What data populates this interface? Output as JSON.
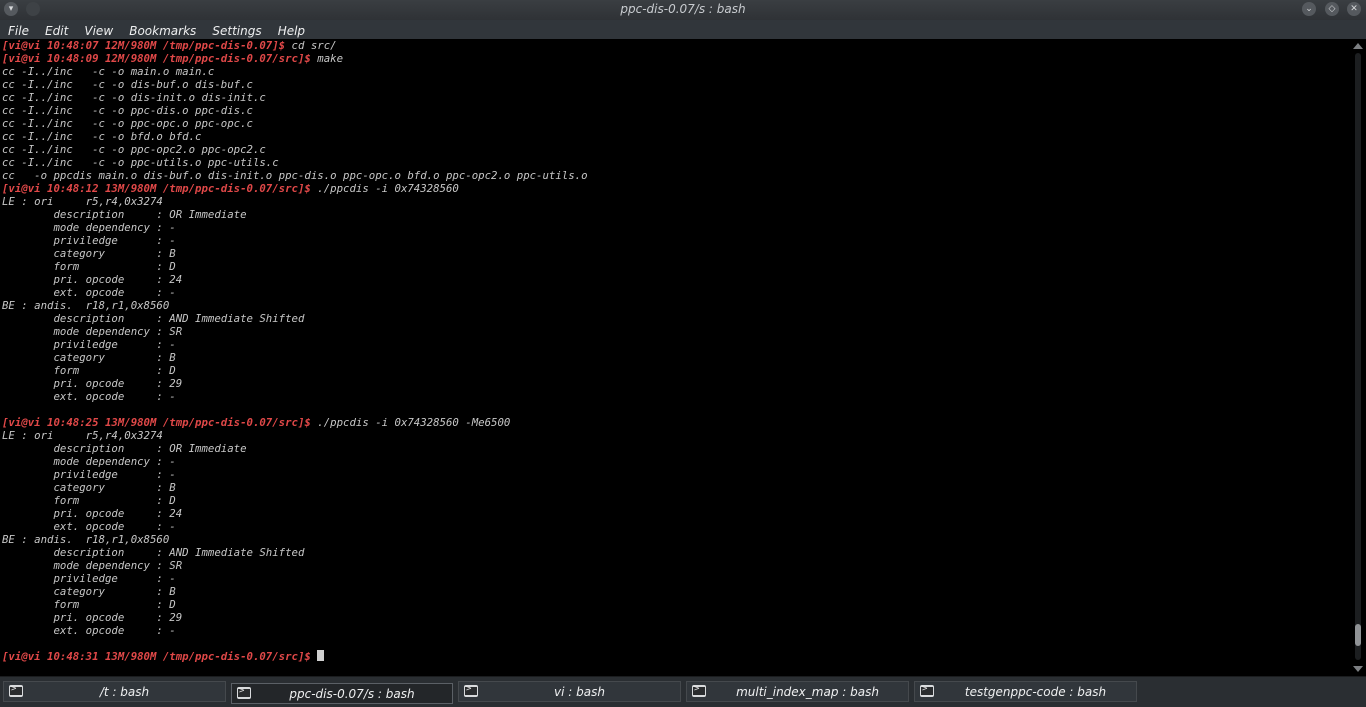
{
  "window": {
    "title": "ppc-dis-0.07/s : bash"
  },
  "menu": [
    "File",
    "Edit",
    "View",
    "Bookmarks",
    "Settings",
    "Help"
  ],
  "terminal": {
    "lines": [
      {
        "prompt": "[vi@vi 10:48:07 12M/980M /tmp/ppc-dis-0.07]$",
        "text": " cd src/"
      },
      {
        "prompt": "[vi@vi 10:48:09 12M/980M /tmp/ppc-dis-0.07/src]$",
        "text": " make"
      },
      {
        "prompt": "",
        "text": "cc -I../inc   -c -o main.o main.c"
      },
      {
        "prompt": "",
        "text": "cc -I../inc   -c -o dis-buf.o dis-buf.c"
      },
      {
        "prompt": "",
        "text": "cc -I../inc   -c -o dis-init.o dis-init.c"
      },
      {
        "prompt": "",
        "text": "cc -I../inc   -c -o ppc-dis.o ppc-dis.c"
      },
      {
        "prompt": "",
        "text": "cc -I../inc   -c -o ppc-opc.o ppc-opc.c"
      },
      {
        "prompt": "",
        "text": "cc -I../inc   -c -o bfd.o bfd.c"
      },
      {
        "prompt": "",
        "text": "cc -I../inc   -c -o ppc-opc2.o ppc-opc2.c"
      },
      {
        "prompt": "",
        "text": "cc -I../inc   -c -o ppc-utils.o ppc-utils.c"
      },
      {
        "prompt": "",
        "text": "cc   -o ppcdis main.o dis-buf.o dis-init.o ppc-dis.o ppc-opc.o bfd.o ppc-opc2.o ppc-utils.o"
      },
      {
        "prompt": "[vi@vi 10:48:12 13M/980M /tmp/ppc-dis-0.07/src]$",
        "text": " ./ppcdis -i 0x74328560"
      },
      {
        "prompt": "",
        "text": "LE : ori     r5,r4,0x3274"
      },
      {
        "prompt": "",
        "text": "        description     : OR Immediate"
      },
      {
        "prompt": "",
        "text": "        mode dependency : -"
      },
      {
        "prompt": "",
        "text": "        priviledge      : -"
      },
      {
        "prompt": "",
        "text": "        category        : B"
      },
      {
        "prompt": "",
        "text": "        form            : D"
      },
      {
        "prompt": "",
        "text": "        pri. opcode     : 24"
      },
      {
        "prompt": "",
        "text": "        ext. opcode     : -"
      },
      {
        "prompt": "",
        "text": "BE : andis.  r18,r1,0x8560"
      },
      {
        "prompt": "",
        "text": "        description     : AND Immediate Shifted"
      },
      {
        "prompt": "",
        "text": "        mode dependency : SR"
      },
      {
        "prompt": "",
        "text": "        priviledge      : -"
      },
      {
        "prompt": "",
        "text": "        category        : B"
      },
      {
        "prompt": "",
        "text": "        form            : D"
      },
      {
        "prompt": "",
        "text": "        pri. opcode     : 29"
      },
      {
        "prompt": "",
        "text": "        ext. opcode     : -"
      },
      {
        "prompt": "",
        "text": ""
      },
      {
        "prompt": "[vi@vi 10:48:25 13M/980M /tmp/ppc-dis-0.07/src]$",
        "text": " ./ppcdis -i 0x74328560 -Me6500"
      },
      {
        "prompt": "",
        "text": "LE : ori     r5,r4,0x3274"
      },
      {
        "prompt": "",
        "text": "        description     : OR Immediate"
      },
      {
        "prompt": "",
        "text": "        mode dependency : -"
      },
      {
        "prompt": "",
        "text": "        priviledge      : -"
      },
      {
        "prompt": "",
        "text": "        category        : B"
      },
      {
        "prompt": "",
        "text": "        form            : D"
      },
      {
        "prompt": "",
        "text": "        pri. opcode     : 24"
      },
      {
        "prompt": "",
        "text": "        ext. opcode     : -"
      },
      {
        "prompt": "",
        "text": "BE : andis.  r18,r1,0x8560"
      },
      {
        "prompt": "",
        "text": "        description     : AND Immediate Shifted"
      },
      {
        "prompt": "",
        "text": "        mode dependency : SR"
      },
      {
        "prompt": "",
        "text": "        priviledge      : -"
      },
      {
        "prompt": "",
        "text": "        category        : B"
      },
      {
        "prompt": "",
        "text": "        form            : D"
      },
      {
        "prompt": "",
        "text": "        pri. opcode     : 29"
      },
      {
        "prompt": "",
        "text": "        ext. opcode     : -"
      },
      {
        "prompt": "",
        "text": ""
      },
      {
        "prompt": "[vi@vi 10:48:31 13M/980M /tmp/ppc-dis-0.07/src]$",
        "text": " ",
        "cursor": true
      }
    ]
  },
  "tabs": [
    {
      "label": "/t : bash",
      "active": false
    },
    {
      "label": "ppc-dis-0.07/s : bash",
      "active": true
    },
    {
      "label": "vi : bash",
      "active": false
    },
    {
      "label": "multi_index_map : bash",
      "active": false
    },
    {
      "label": "testgenppc-code : bash",
      "active": false
    }
  ],
  "colors": {
    "prompt": "#e04848",
    "text": "#c7c7c7",
    "background": "#000000"
  },
  "icons": {
    "tab": "terminal-icon",
    "titlebar": [
      "minimize-icon",
      "maximize-icon",
      "close-icon"
    ]
  }
}
